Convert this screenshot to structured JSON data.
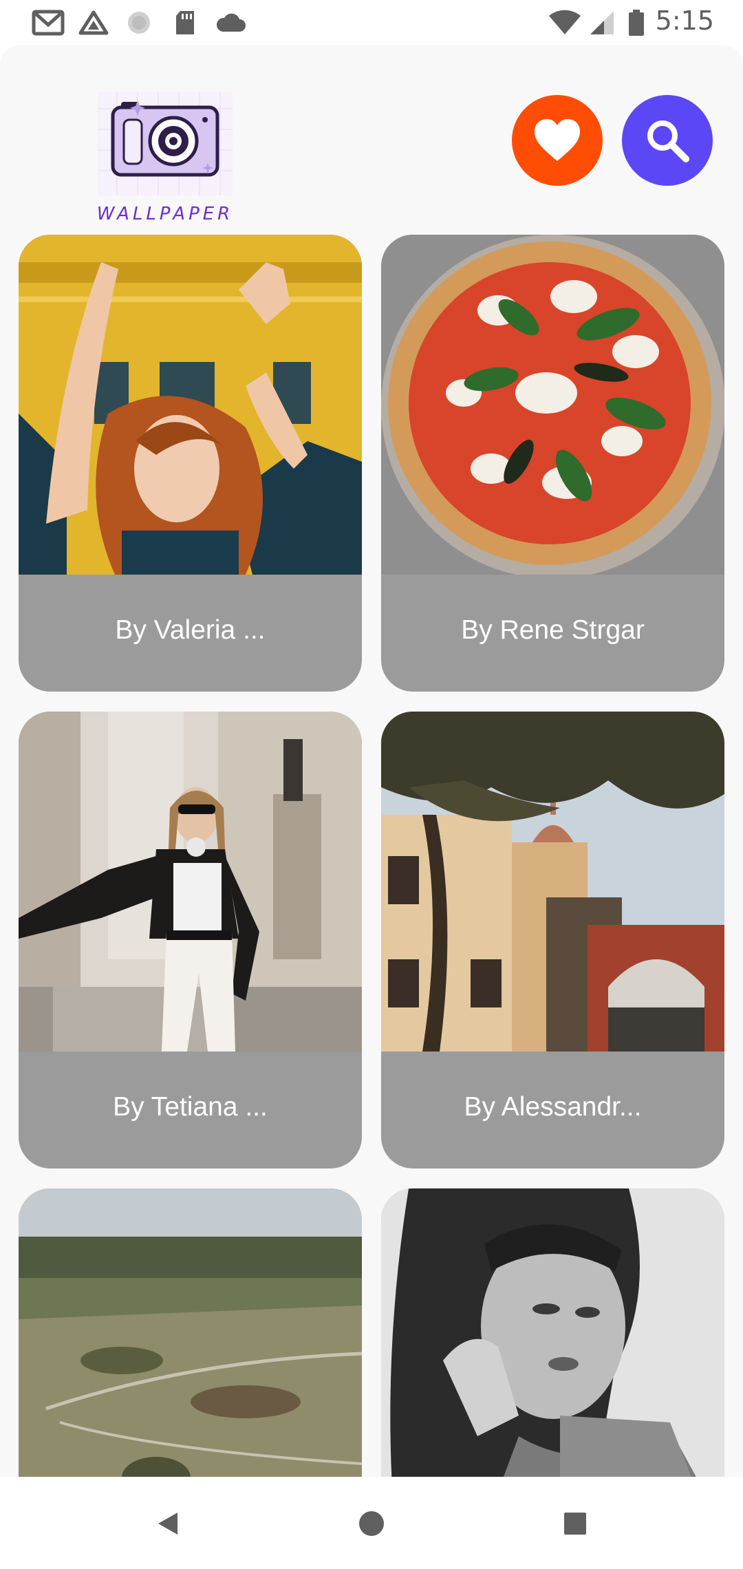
{
  "status_bar": {
    "time": "5:15",
    "left_icons": [
      "gmail-icon",
      "drive-icon",
      "sync-circle-icon",
      "sd-card-icon",
      "cloud-icon"
    ],
    "right_icons": [
      "wifi-icon",
      "cell-signal-icon",
      "battery-icon"
    ]
  },
  "header": {
    "logo_text": "WALLPAPER",
    "favorites_icon": "heart-icon",
    "search_icon": "search-icon"
  },
  "colors": {
    "favorites_button": "#ff4d06",
    "search_button": "#5b47f5",
    "card_label_bg": "#9b9b9b",
    "logo_purple": "#6a2fcf"
  },
  "wallpapers": [
    {
      "label": "By Valeria ...",
      "subject": "woman with curly red hair, arms raised, yellow building"
    },
    {
      "label": "By Rene Strgar",
      "subject": "margherita pizza with basil"
    },
    {
      "label": "By Tetiana ...",
      "subject": "woman in black jacket and white jeans on street"
    },
    {
      "label": "By Alessandr...",
      "subject": "town street with dome and tree"
    },
    {
      "label": "",
      "subject": "aerial landscape with forest"
    },
    {
      "label": "",
      "subject": "black and white portrait of woman"
    }
  ],
  "nav": {
    "back": "back-icon",
    "home": "home-icon",
    "recents": "recents-icon"
  }
}
